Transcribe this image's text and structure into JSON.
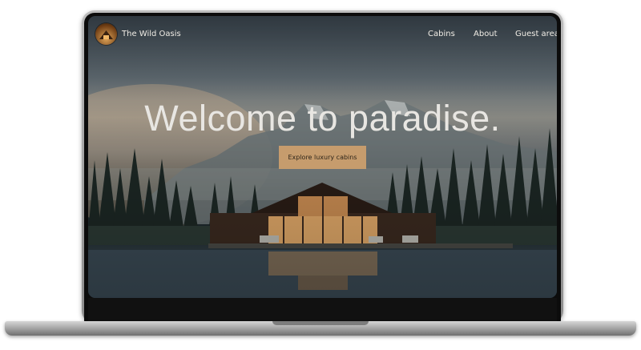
{
  "brand": {
    "name": "The Wild Oasis"
  },
  "nav": {
    "items": [
      {
        "label": "Cabins"
      },
      {
        "label": "About"
      },
      {
        "label": "Guest area"
      }
    ]
  },
  "hero": {
    "title": "Welcome to paradise.",
    "cta_label": "Explore luxury cabins"
  },
  "colors": {
    "accent": "#c69c6d",
    "text": "#f1ede6"
  }
}
